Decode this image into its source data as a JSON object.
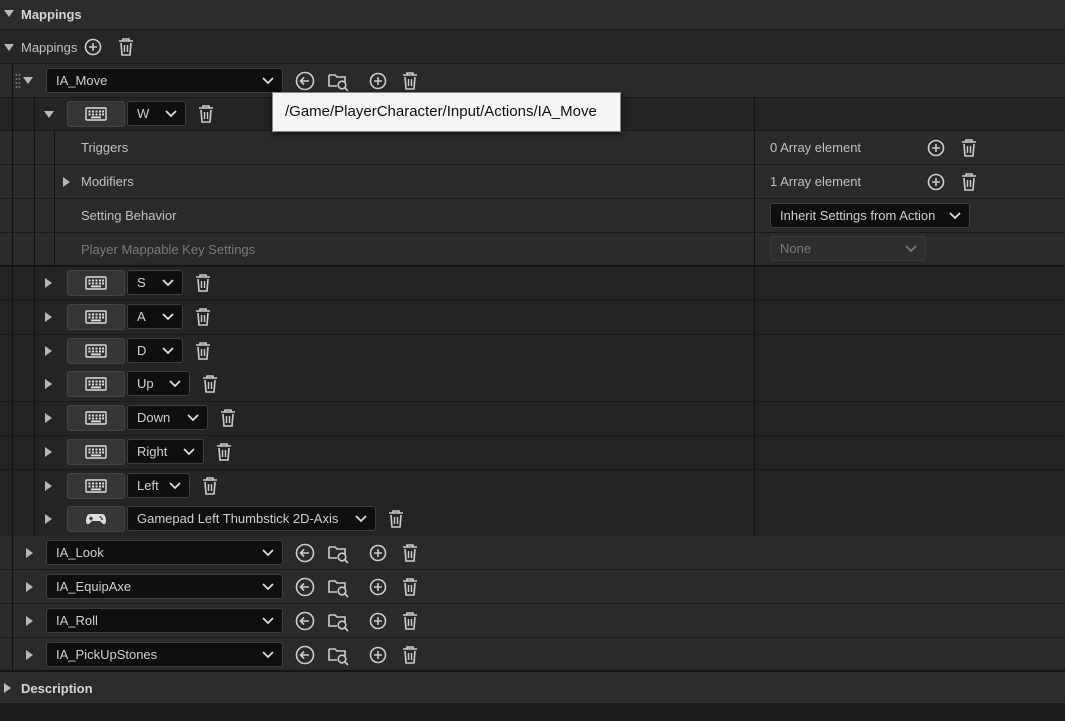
{
  "sections": {
    "mappings_header": "Mappings",
    "description_header": "Description"
  },
  "mappings": {
    "label": "Mappings",
    "active_action": {
      "name": "IA_Move",
      "tooltip_path": "/Game/PlayerCharacter/Input/Actions/IA_Move",
      "first_key": {
        "key": "W",
        "properties": [
          {
            "label": "Triggers",
            "value": "0 Array element"
          },
          {
            "label": "Modifiers",
            "value": "1 Array element"
          },
          {
            "label": "Setting Behavior",
            "value": "Inherit Settings from Action"
          },
          {
            "label": "Player Mappable Key Settings",
            "value": "None"
          }
        ]
      },
      "other_keys": [
        {
          "key": "S",
          "device": "keyboard-icon"
        },
        {
          "key": "A",
          "device": "keyboard-icon"
        },
        {
          "key": "D",
          "device": "keyboard-icon"
        },
        {
          "key": "Up",
          "device": "keyboard-icon"
        },
        {
          "key": "Down",
          "device": "keyboard-icon"
        },
        {
          "key": "Right",
          "device": "keyboard-icon"
        },
        {
          "key": "Left",
          "device": "keyboard-icon"
        },
        {
          "key": "Gamepad Left Thumbstick 2D-Axis",
          "device": "gamepad-icon"
        }
      ]
    },
    "other_actions": [
      "IA_Look",
      "IA_EquipAxe",
      "IA_Roll",
      "IA_PickUpStones"
    ]
  }
}
